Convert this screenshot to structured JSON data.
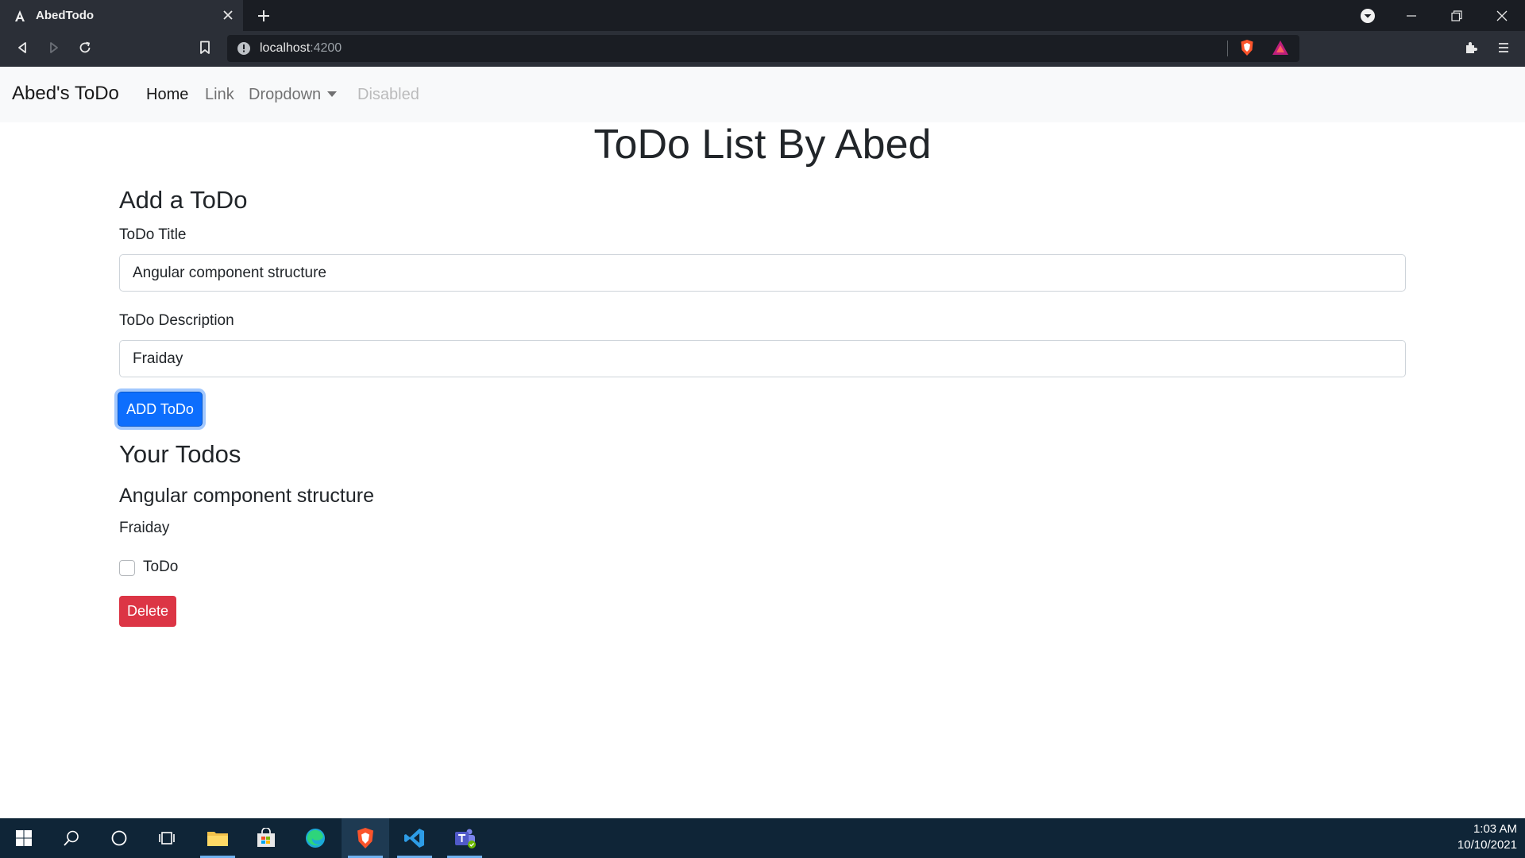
{
  "browser": {
    "tab_title": "AbedTodo",
    "url_host": "localhost",
    "url_port": ":4200"
  },
  "navbar": {
    "brand": "Abed's ToDo",
    "links": [
      {
        "label": "Home"
      },
      {
        "label": "Link"
      },
      {
        "label": "Dropdown"
      },
      {
        "label": "Disabled"
      }
    ]
  },
  "page": {
    "title": "ToDo List By Abed",
    "add_heading": "Add a ToDo",
    "title_label": "ToDo Title",
    "title_value": "Angular component structure",
    "desc_label": "ToDo Description",
    "desc_value": "Fraiday",
    "add_button": "ADD ToDo",
    "list_heading": "Your Todos"
  },
  "todos": [
    {
      "title": "Angular component structure",
      "description": "Fraiday",
      "checkbox_label": "ToDo",
      "delete_label": "Delete"
    }
  ],
  "taskbar": {
    "time": "1:03 AM",
    "date": "10/10/2021"
  },
  "colors": {
    "primary": "#0d6efd",
    "danger": "#dc3545",
    "navbar_bg": "#f8f9fa",
    "taskbar_bg": "#0f2537"
  }
}
